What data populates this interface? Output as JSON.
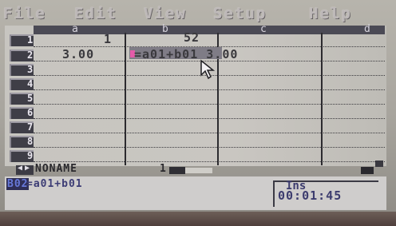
{
  "menu": {
    "items": [
      {
        "label": "File"
      },
      {
        "label": "Edit"
      },
      {
        "label": "View"
      },
      {
        "label": "Setup"
      },
      {
        "label": "Help"
      }
    ]
  },
  "sheet": {
    "columns": [
      "a",
      "b",
      "c",
      "d"
    ],
    "rows": [
      "1",
      "2",
      "3",
      "4",
      "5",
      "6",
      "7",
      "8",
      "9"
    ],
    "cells": {
      "a1": "1",
      "b1": "52",
      "a2": "3.00",
      "b2": "=a01+b01 3.00"
    }
  },
  "tabbar": {
    "sheet_name": "NONAME",
    "sheet_number": "1"
  },
  "status": {
    "cell_ref": "B02",
    "formula": "=a01+b01",
    "mode": "Ins",
    "clock": "00:01:45"
  },
  "colors": {
    "column_header": "#4b4a55",
    "row_header": "#3f3e47",
    "selected_cell": "#7f7c86",
    "cursor_mark": "#e45ba9",
    "status_text": "#3c3c6e"
  }
}
